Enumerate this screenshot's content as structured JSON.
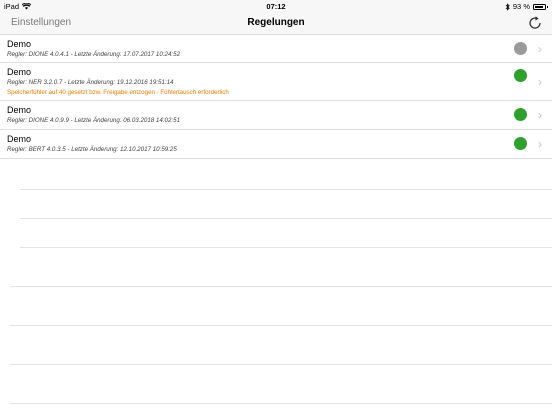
{
  "statusbar": {
    "device": "iPad",
    "time": "07:12",
    "battery": "93 %",
    "battery_level": 0.93
  },
  "navbar": {
    "back_label": "Einstellungen",
    "title": "Regelungen"
  },
  "colors": {
    "ok": "#2ea02e",
    "inactive": "#9a9a9a",
    "warning": "#f07c00"
  },
  "rows": [
    {
      "title": "Demo",
      "subtitle": "Regler: DIONE 4.0.4.1  - Letzte Änderung: 17.07.2017 10:24:52",
      "warning": "",
      "status": "inactive"
    },
    {
      "title": "Demo",
      "subtitle": "Regler: NER 3.2.0.7  - Letzte Änderung: 19.12.2016 19:51:14",
      "warning": "Speicherfühler auf 40 gesetzt bzw. Freigabe entzogen - Fühlertausch erforderlich",
      "status": "ok"
    },
    {
      "title": "Demo",
      "subtitle": "Regler: DIONE 4.0.9.9  - Letzte Änderung: 06.03.2018 14:02:51",
      "warning": "",
      "status": "ok"
    },
    {
      "title": "Demo",
      "subtitle": "Regler: BERT 4.0.3.5  - Letzte Änderung: 12.10.2017 10:59:25",
      "warning": "",
      "status": "ok"
    }
  ]
}
